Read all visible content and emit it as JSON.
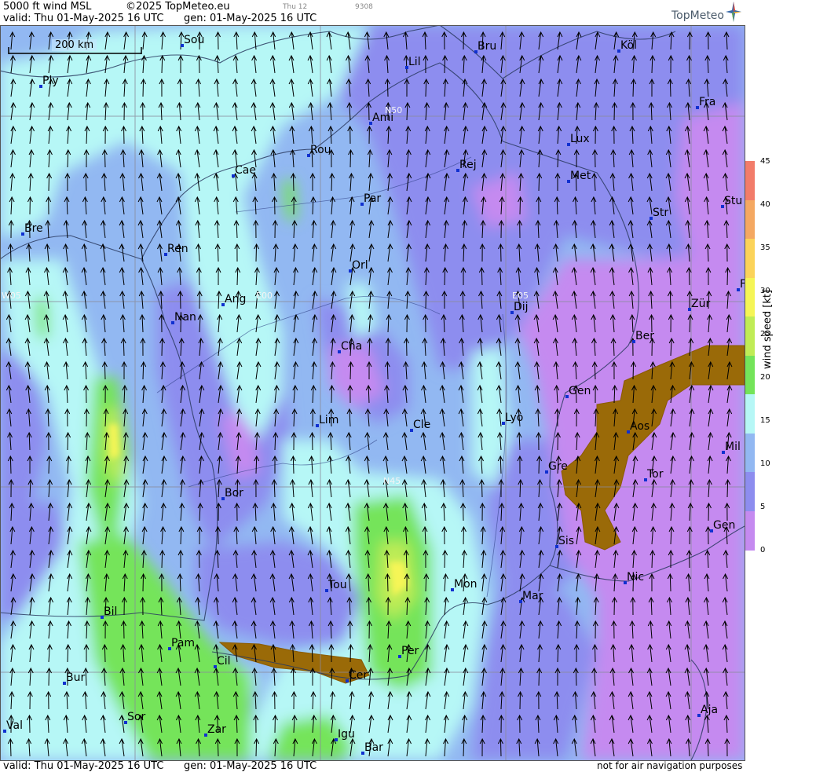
{
  "header": {
    "product": "5000 ft wind MSL",
    "copyright": "©2025 TopMeteo.eu",
    "day_code": "Thu 12",
    "code": "9308",
    "valid": "valid:  Thu  01-May-2025  16 UTC",
    "gen": "gen: 01-May-2025 16 UTC"
  },
  "logo": {
    "text": "TopMeteo",
    "icon": "compass-star-icon"
  },
  "footer": {
    "valid": "valid:  Thu  01-May-2025  16 UTC",
    "gen": "gen: 01-May-2025 16 UTC",
    "disclaimer": "not for air navigation purposes"
  },
  "scale": {
    "label": "200 km"
  },
  "colorbar": {
    "title": "wind speed [kt]",
    "ticks": [
      "45",
      "40",
      "35",
      "30",
      "25",
      "20",
      "15",
      "10",
      "5",
      "0"
    ],
    "colors": [
      "#f27c6a",
      "#f4a862",
      "#fbd35a",
      "#f5f556",
      "#c0ec56",
      "#74e45a",
      "#b6f7f6",
      "#92b8f2",
      "#8d8def",
      "#c58af0"
    ]
  },
  "grid_labels": [
    "N50",
    "E05",
    "E00",
    "N45",
    "W05"
  ],
  "cities": [
    "Ply",
    "Sou",
    "Lil",
    "Bru",
    "Köl",
    "Ami",
    "Fra",
    "Lux",
    "Rou",
    "Cae",
    "Rej",
    "Met",
    "Par",
    "Bre",
    "Str",
    "Stu",
    "Ren",
    "Orl",
    "Ang",
    "Nan",
    "Dij",
    "Zür",
    "Ber",
    "Cha",
    "Gen",
    "Lim",
    "Cle",
    "Lyo",
    "Aos",
    "Mil",
    "Tor",
    "Gre",
    "Bor",
    "Sis",
    "Gen",
    "Tou",
    "Mon",
    "Mar",
    "Nic",
    "Bil",
    "Pam",
    "Cil",
    "Per",
    "Cer",
    "Bur",
    "Sor",
    "Val",
    "Zar",
    "Igu",
    "Bar",
    "Aja",
    "F"
  ],
  "wind": {
    "direction": "northward arrows (southerly flow)"
  }
}
